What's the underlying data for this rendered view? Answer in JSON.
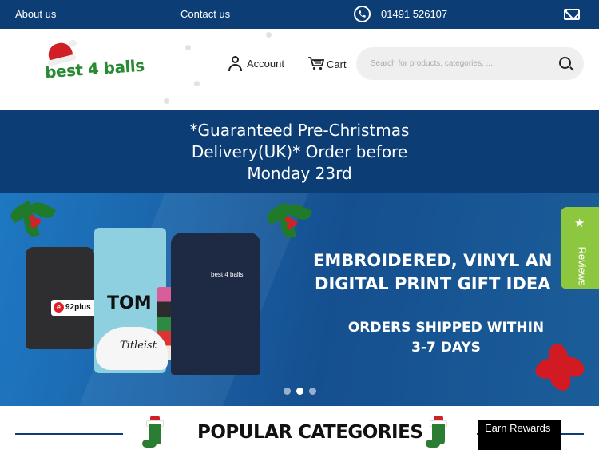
{
  "topbar": {
    "about_label": "About us",
    "contact_label": "Contact us",
    "phone": "01491 526107",
    "phone_icon": "phone-icon",
    "mail_icon": "mail-icon"
  },
  "header": {
    "logo_text": "best 4 balls",
    "account_label": "Account",
    "cart_label": "Cart",
    "search_placeholder": "Search for products, categories, ..."
  },
  "banner": {
    "line1": "*Guaranteed Pre-Christmas",
    "line2": "Delivery(UK)*  Order before",
    "line3": "Monday 23rd"
  },
  "hero": {
    "headline1": "EMBROIDERED, VINYL AN",
    "headline2": "DIGITAL PRINT GIFT IDEA",
    "sub1": "ORDERS SHIPPED WITHIN",
    "sub2": "3-7 DAYS",
    "towel_text": "TOM",
    "bag_text": "92plus",
    "cap_text": "Titleist",
    "shirt_text": "best 4 balls",
    "carousel_dots": 3,
    "active_dot": 2
  },
  "reviews_tab": {
    "label": "Reviews",
    "icon": "star-icon"
  },
  "section": {
    "title": "POPULAR CATEGORIES"
  },
  "earn_rewards": {
    "label": "Earn Rewards"
  },
  "colors": {
    "navy": "#0c3e75",
    "green": "#2a8a33",
    "reviews_green": "#8dc63f",
    "red": "#d11f26"
  }
}
